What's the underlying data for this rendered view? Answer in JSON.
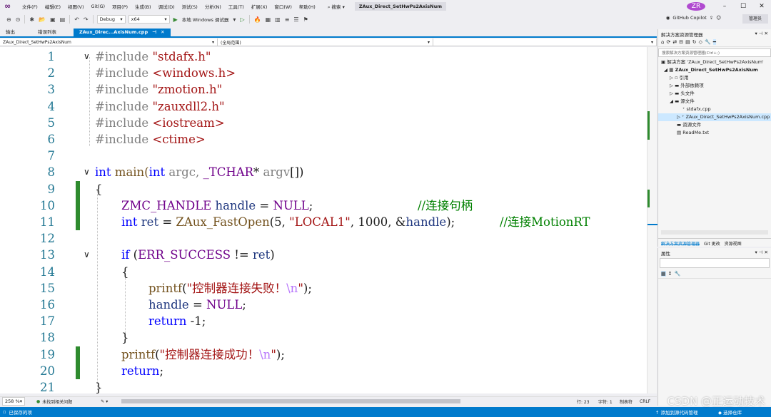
{
  "menu": {
    "items": [
      "文件(F)",
      "编辑(E)",
      "视图(V)",
      "Git(G)",
      "项目(P)",
      "生成(B)",
      "调试(D)",
      "测试(S)",
      "分析(N)",
      "工具(T)",
      "扩展(X)",
      "窗口(W)",
      "帮助(H)"
    ],
    "search": "搜索",
    "solution_title": "ZAux_Direct_SetHwPs2AxisNum",
    "avatar": "ZR"
  },
  "toolbar": {
    "config": "Debug",
    "platform": "x64",
    "run_label": "本地 Windows 调试器",
    "copilot": "GitHub Copilot",
    "admin": "管理员"
  },
  "tabs": [
    "输出",
    "错误列表",
    "ZAux_Direc...AxisNum.cpp"
  ],
  "navbar": {
    "project": "ZAux_Direct_SetHwPs2AxisNum",
    "scope": "(全局范围)",
    "member": ""
  },
  "code_lines": [
    {
      "n": "1"
    },
    {
      "n": "2"
    },
    {
      "n": "3"
    },
    {
      "n": "4"
    },
    {
      "n": "5"
    },
    {
      "n": "6"
    },
    {
      "n": "7"
    },
    {
      "n": "8"
    },
    {
      "n": "9"
    },
    {
      "n": "10"
    },
    {
      "n": "11"
    },
    {
      "n": "12"
    },
    {
      "n": "13"
    },
    {
      "n": "14"
    },
    {
      "n": "15"
    },
    {
      "n": "16"
    },
    {
      "n": "17"
    },
    {
      "n": "18"
    },
    {
      "n": "19"
    },
    {
      "n": "20"
    },
    {
      "n": "21"
    }
  ],
  "code": {
    "inc1": "#include ",
    "inc1s": "\"stdafx.h\"",
    "inc2": "#include ",
    "inc2s": "<windows.h>",
    "inc3": "#include ",
    "inc3s": "\"zmotion.h\"",
    "inc4": "#include ",
    "inc4s": "\"zauxdll2.h\"",
    "inc5": "#include ",
    "inc5s": "<iostream>",
    "inc6": "#include ",
    "inc6s": "<ctime>",
    "main_int": "int",
    "main_name": " main(",
    "main_int2": "int",
    "main_argc": " argc, ",
    "main_tchar": "_TCHAR",
    "main_star": "* ",
    "main_argv": "argv",
    "main_end": "[])",
    "brace_open": "{",
    "l10_type": "ZMC_HANDLE",
    "l10_var": " handle",
    "l10_eq": " = ",
    "l10_null": "NULL",
    "l10_semi": ";",
    "l10_com": "//连接句柄",
    "l11_int": "int",
    "l11_var": " ret",
    "l11_eq": " = ",
    "l11_fn": "ZAux_FastOpen",
    "l11_a": "(5, ",
    "l11_str": "\"LOCAL1\"",
    "l11_b": ", 1000, &",
    "l11_h": "handle",
    "l11_c": ");",
    "l11_com": "//连接MotionRT",
    "l13_if": "if",
    "l13_a": " (",
    "l13_mac": "ERR_SUCCESS",
    "l13_b": " != ",
    "l13_ret": "ret",
    "l13_c": ")",
    "l14": "{",
    "l15_fn": "printf",
    "l15_a": "(",
    "l15_str": "\"控制器连接失败！",
    "l15_esc": "\\n",
    "l15_q": "\"",
    "l15_b": ");",
    "l16_var": "handle",
    "l16_eq": " = ",
    "l16_null": "NULL",
    "l16_semi": ";",
    "l17_kw": "return",
    "l17_val": " -1;",
    "l18": "}",
    "l19_fn": "printf",
    "l19_a": "(",
    "l19_str": "\"控制器连接成功！",
    "l19_esc": "\\n",
    "l19_q": "\"",
    "l19_b": ");",
    "l20_kw": "return",
    "l20_semi": ";",
    "l21": "}"
  },
  "editor_status": {
    "zoom": "258 %",
    "issues": "未找到相关问题",
    "line": "行: 23",
    "col": "字符: 1",
    "tab": "制表符",
    "eol": "CRLF"
  },
  "solution_explorer": {
    "title": "解决方案资源管理器",
    "search_placeholder": "搜索解决方案资源管理器(Ctrl+;)",
    "solution": "解决方案 'ZAux_Direct_SetHwPs2AxisNum'",
    "project": "ZAux_Direct_SetHwPs2AxisNum",
    "refs": "引用",
    "external": "外部依赖项",
    "headers": "头文件",
    "sources": "源文件",
    "file1": "stdafx.cpp",
    "file2": "ZAux_Direct_SetHwPs2AxisNum.cpp",
    "resources": "资源文件",
    "readme": "ReadMe.txt",
    "bottom_tabs": [
      "解决方案资源管理器",
      "Git 更改",
      "资源视图"
    ]
  },
  "properties": {
    "title": "属性"
  },
  "statusbar": {
    "ready": "已保存的项",
    "add_source": "添加到源代码管理",
    "select_repo": "选择仓库"
  },
  "watermark": "CSDN @正运动技术"
}
